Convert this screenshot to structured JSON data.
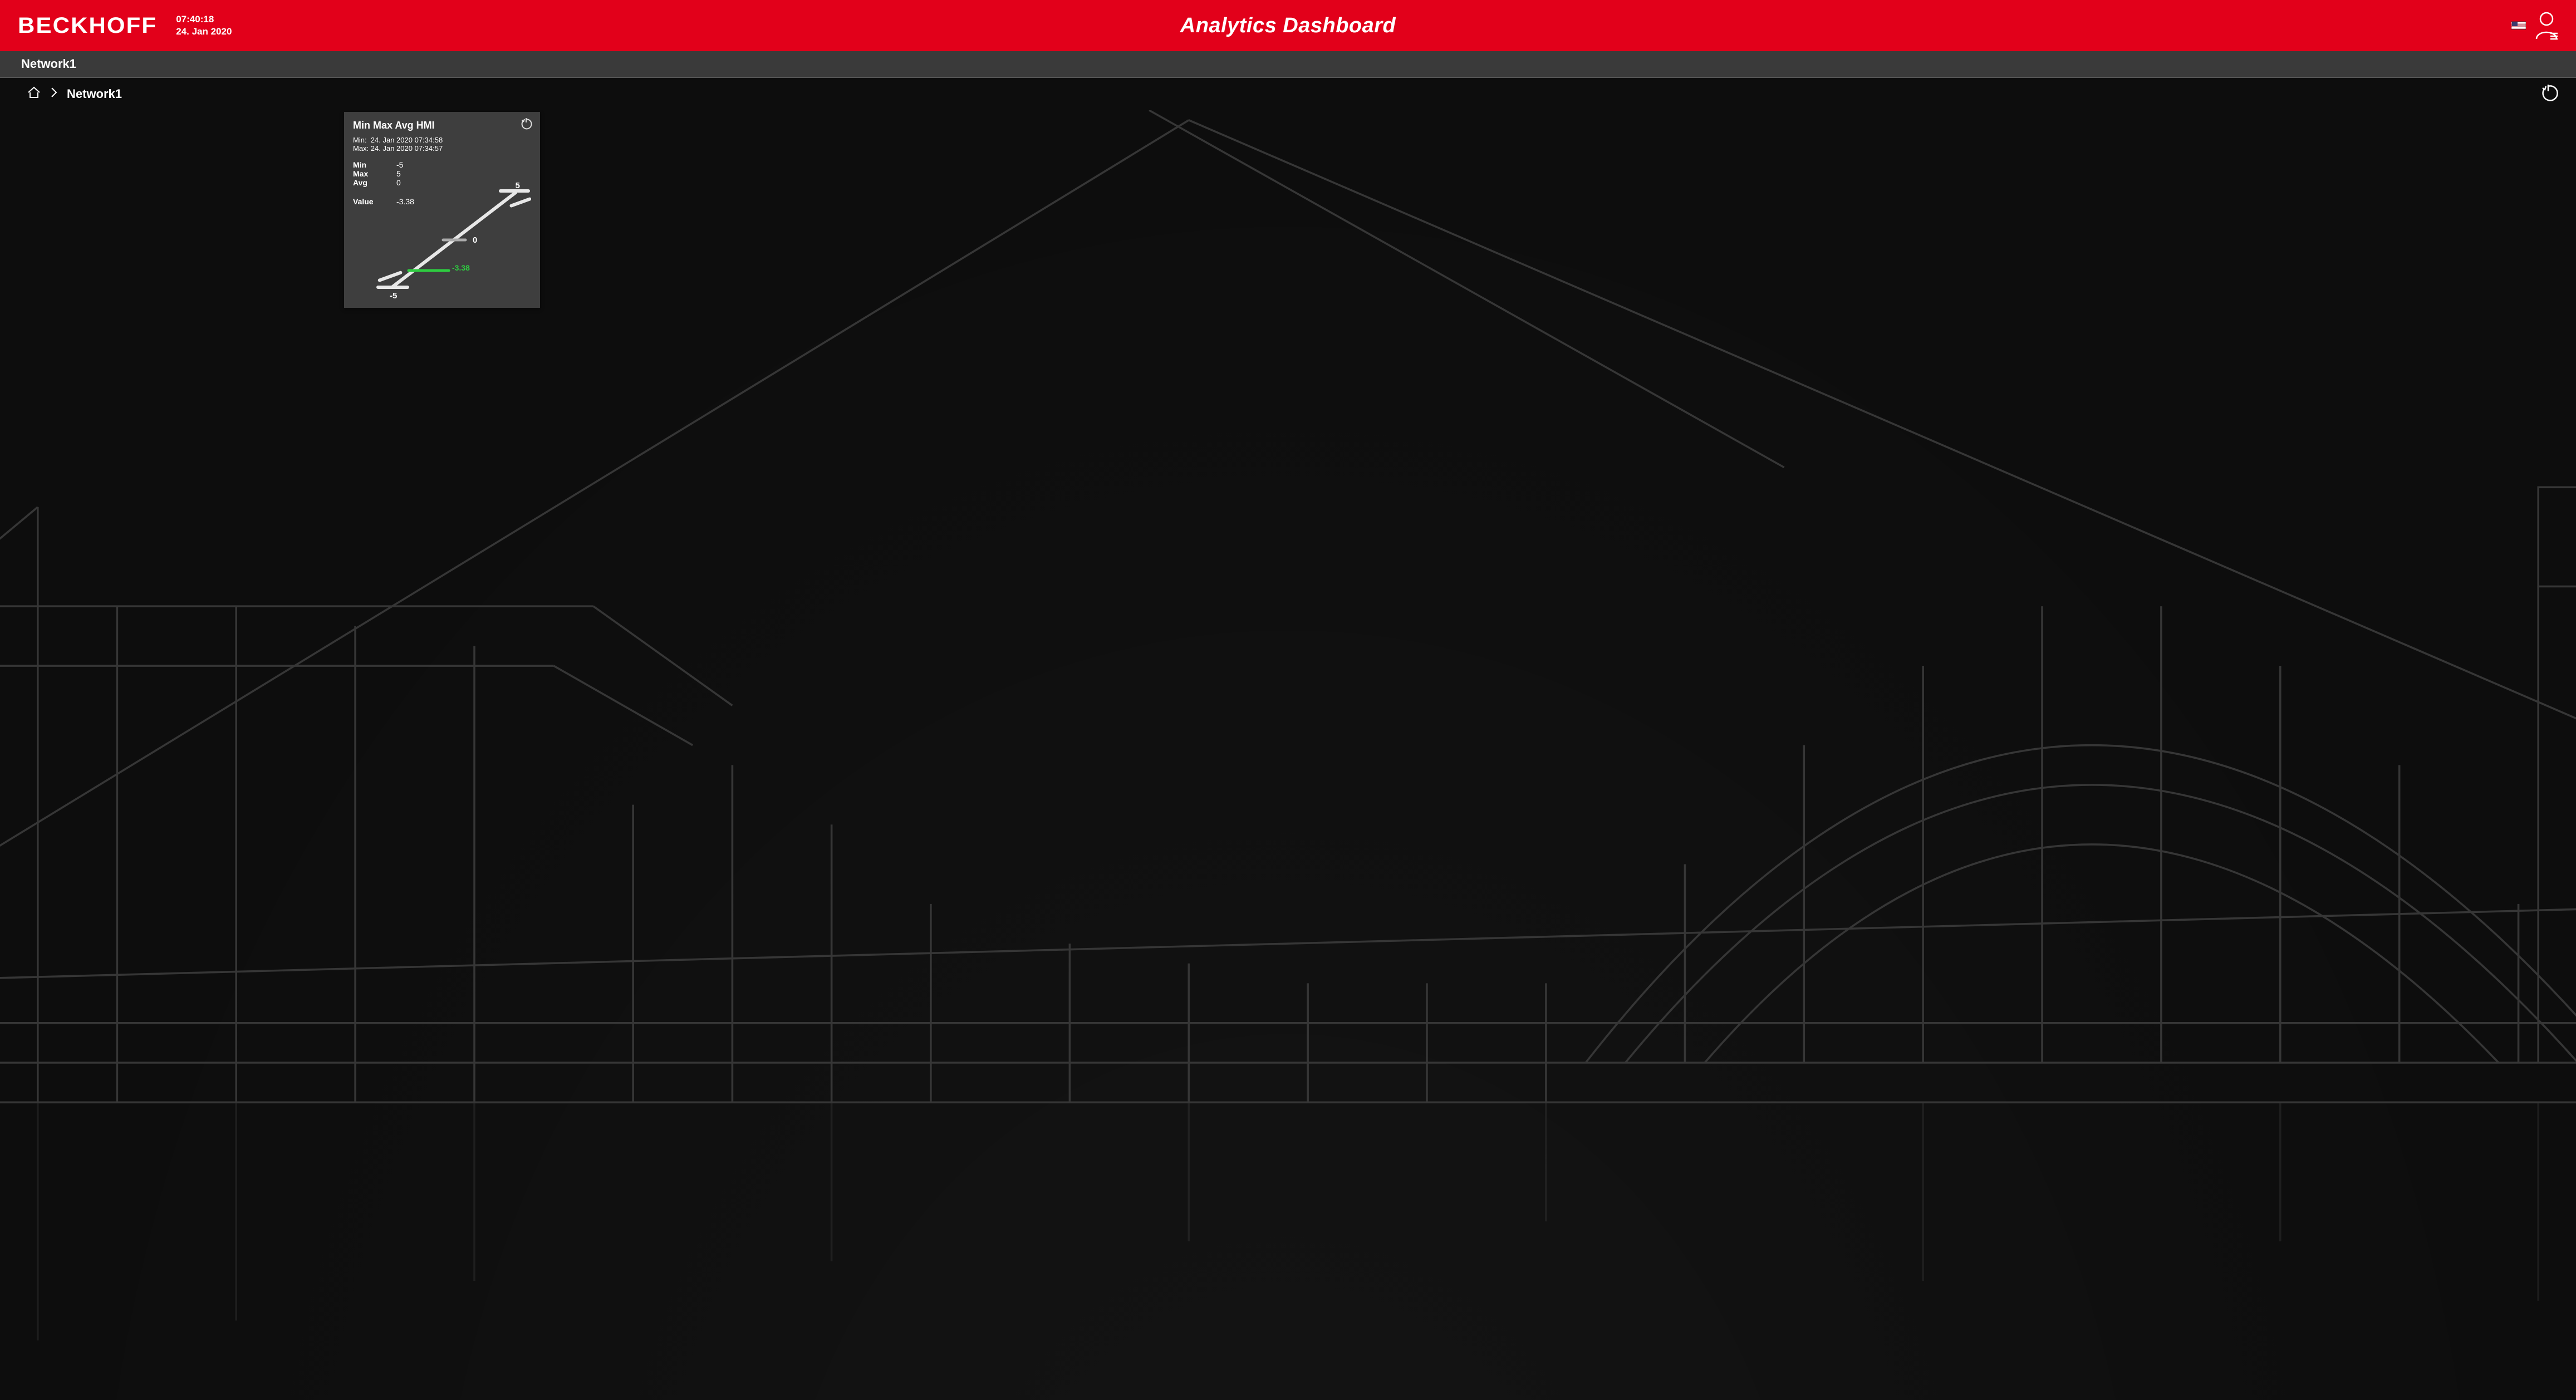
{
  "header": {
    "logo_text": "BECKHOFF",
    "time": "07:40:18",
    "date": "24. Jan 2020",
    "title": "Analytics Dashboard",
    "locale_flag": "us"
  },
  "tabs": {
    "active": "Network1"
  },
  "breadcrumb": {
    "segments": [
      "Network1"
    ]
  },
  "card": {
    "title": "Min Max Avg HMI",
    "timestamps": {
      "min_label": "Min:",
      "min_value": "24. Jan 2020 07:34:58",
      "max_label": "Max:",
      "max_value": "24. Jan 2020 07:34:57"
    },
    "stats": {
      "min_label": "Min",
      "min_value": "-5",
      "max_label": "Max",
      "max_value": "5",
      "avg_label": "Avg",
      "avg_value": "0"
    },
    "current": {
      "label": "Value",
      "value": "-3.38"
    },
    "scale": {
      "top_label": "5",
      "mid_label": "0",
      "bottom_label": "-5",
      "marker_label": "-3.38"
    }
  },
  "chart_data": {
    "type": "scatter",
    "title": "Min Max Avg HMI",
    "y_range": [
      -5,
      5
    ],
    "ticks": [
      -5,
      0,
      5
    ],
    "series": [
      {
        "name": "Min",
        "value": -5
      },
      {
        "name": "Max",
        "value": 5
      },
      {
        "name": "Avg",
        "value": 0
      },
      {
        "name": "Value",
        "value": -3.38
      }
    ],
    "current_value": -3.38,
    "accent_color": "#2ecc40"
  }
}
